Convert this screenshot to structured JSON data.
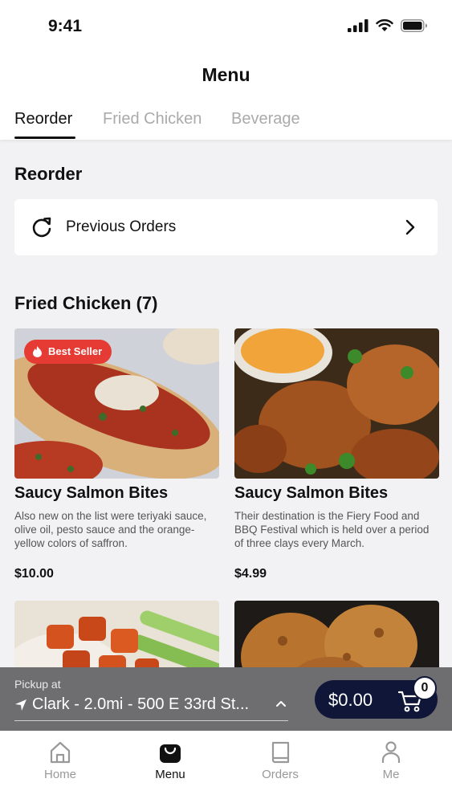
{
  "status_bar": {
    "time": "9:41"
  },
  "header": {
    "title": "Menu"
  },
  "tabs": [
    {
      "label": "Reorder",
      "active": true
    },
    {
      "label": "Fried Chicken",
      "active": false
    },
    {
      "label": "Beverage",
      "active": false
    }
  ],
  "reorder": {
    "section_title": "Reorder",
    "previous_orders_label": "Previous Orders"
  },
  "fried_chicken": {
    "section_title": "Fried Chicken (7)",
    "items": [
      {
        "name": "Saucy Salmon Bites",
        "description": "Also new on the list were teriyaki sauce, olive oil, pesto sauce and the orange-yellow colors of saffron.",
        "price": "$10.00",
        "badge": "Best Seller"
      },
      {
        "name": "Saucy Salmon Bites",
        "description": "Their destination is the Fiery Food and BBQ Festival which is held over a period of three clays every March.",
        "price": "$4.99"
      }
    ]
  },
  "pickup": {
    "label": "Pickup at",
    "location": "Clark - 2.0mi - 500 E 33rd St..."
  },
  "cart": {
    "total": "$0.00",
    "count": "0"
  },
  "bottom_nav": [
    {
      "label": "Home",
      "icon": "home-icon",
      "active": false
    },
    {
      "label": "Menu",
      "icon": "bag-icon",
      "active": true
    },
    {
      "label": "Orders",
      "icon": "book-icon",
      "active": false
    },
    {
      "label": "Me",
      "icon": "person-icon",
      "active": false
    }
  ],
  "colors": {
    "badge": "#e63b34",
    "cart_button": "#101637",
    "pickup_bar": "#6e6e70",
    "accent_dark": "#111111"
  }
}
